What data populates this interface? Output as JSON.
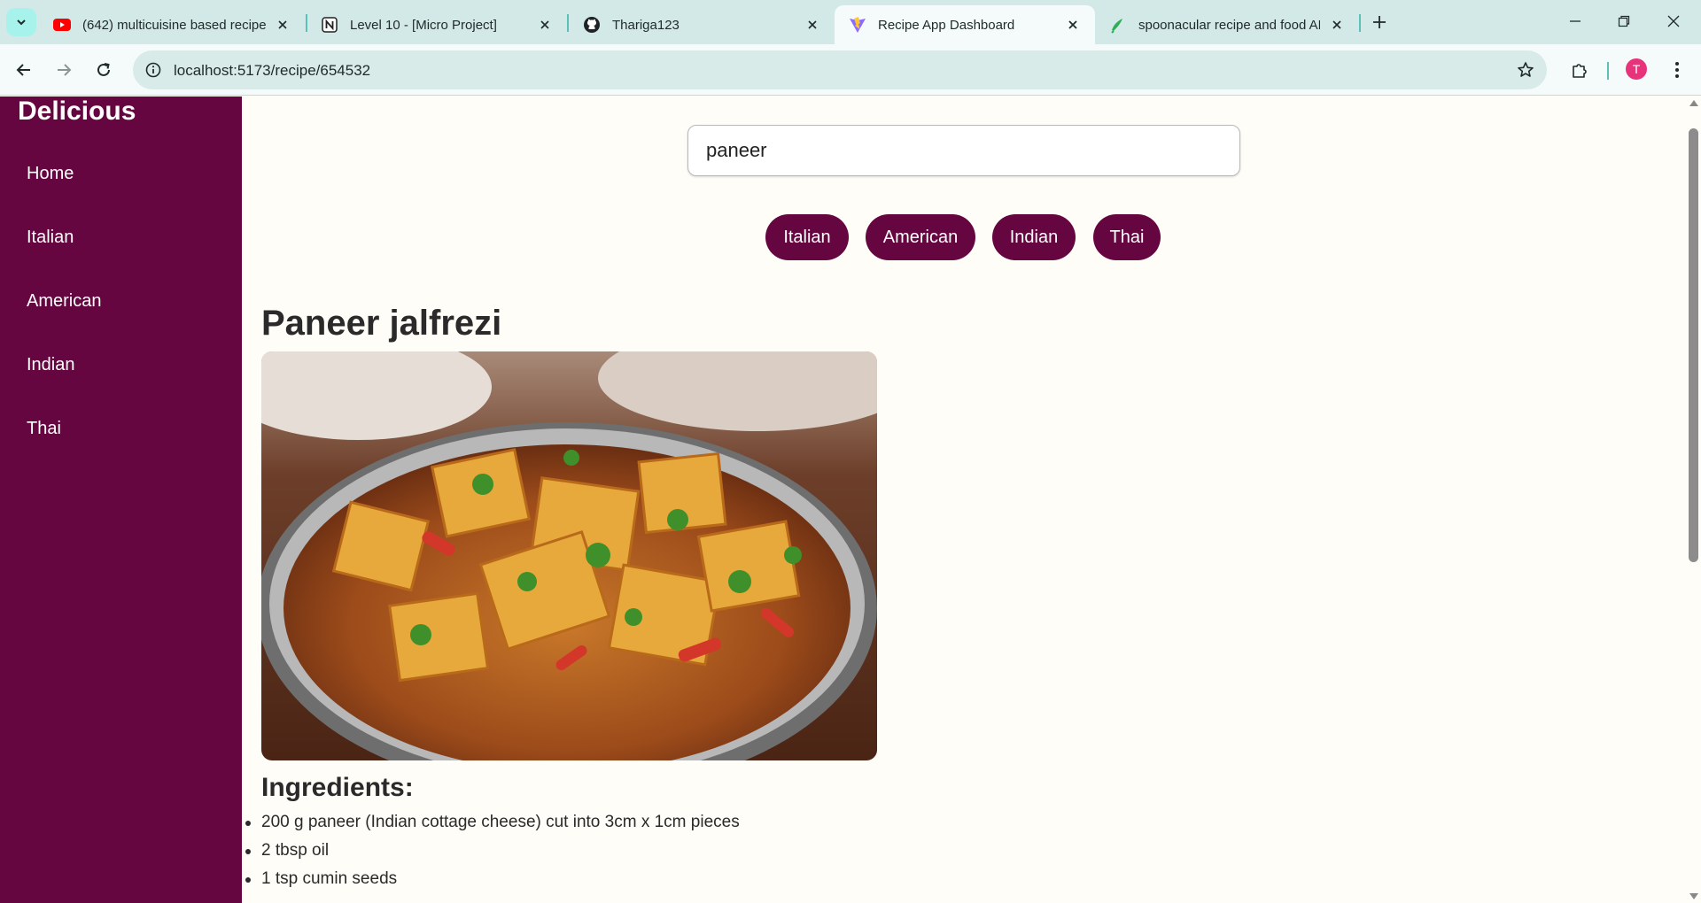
{
  "browser": {
    "tabs": [
      {
        "title": "(642) multicuisine based recipe",
        "icon": "youtube-icon",
        "active": false
      },
      {
        "title": "Level 10 - [Micro Project]",
        "icon": "notion-icon",
        "active": false
      },
      {
        "title": "Thariga123",
        "icon": "github-icon",
        "active": false
      },
      {
        "title": "Recipe App Dashboard",
        "icon": "vite-icon",
        "active": true
      },
      {
        "title": "spoonacular recipe and food API",
        "icon": "spoonacular-icon",
        "active": false
      }
    ],
    "url": "localhost:5173/recipe/654532",
    "profile_initial": "T"
  },
  "app": {
    "brand": "Delicious",
    "sidebar": [
      "Home",
      "Italian",
      "American",
      "Indian",
      "Thai"
    ],
    "search_value": "paneer",
    "cuisines": [
      "Italian",
      "American",
      "Indian",
      "Thai"
    ],
    "recipe": {
      "title": "Paneer jalfrezi",
      "ingredients_heading": "Ingredients:",
      "ingredients": [
        "200 g paneer (Indian cottage cheese) cut into 3cm x 1cm pieces",
        "2 tbsp oil",
        "1 tsp cumin seeds"
      ]
    }
  },
  "colors": {
    "primary": "#660640",
    "background": "#fffdf8",
    "browser_chrome": "#d3e9e7"
  }
}
